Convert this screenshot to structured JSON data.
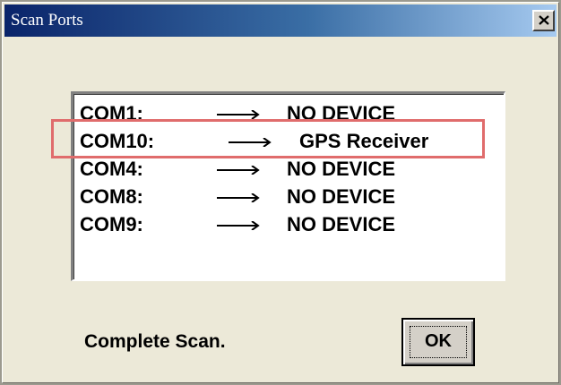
{
  "window": {
    "title": "Scan Ports",
    "close_icon": "close-x-icon"
  },
  "ports": [
    {
      "port": "COM1:",
      "status": "NO DEVICE"
    },
    {
      "port": "COM10:",
      "status": "GPS Receiver",
      "highlighted": true
    },
    {
      "port": "COM4:",
      "status": "NO DEVICE"
    },
    {
      "port": "COM8:",
      "status": "NO DEVICE"
    },
    {
      "port": "COM9:",
      "status": "NO DEVICE"
    }
  ],
  "footer": {
    "status_text": "Complete Scan.",
    "ok_label": "OK"
  },
  "colors": {
    "highlight_border": "#e06c6c",
    "title_gradient_start": "#0a246a",
    "title_gradient_end": "#a6caf0"
  }
}
